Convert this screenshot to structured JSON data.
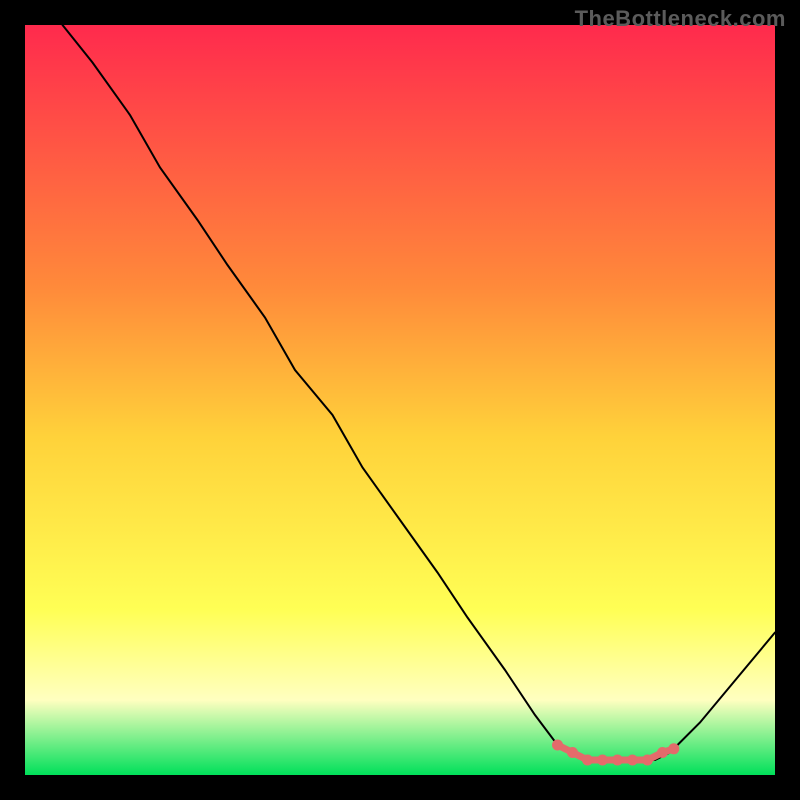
{
  "watermark": "TheBottleneck.com",
  "colors": {
    "gradient_top": "#ff2a4d",
    "gradient_upper_mid": "#ff8a3a",
    "gradient_mid": "#ffd23a",
    "gradient_lower_mid": "#ffff55",
    "gradient_low": "#ffffc0",
    "gradient_bottom": "#00e05a",
    "curve": "#000000",
    "markers": "#e46b6b",
    "frame": "#000000"
  },
  "chart_data": {
    "type": "line",
    "title": "",
    "xlabel": "",
    "ylabel": "",
    "x_range": [
      0,
      100
    ],
    "y_range": [
      0,
      100
    ],
    "series": [
      {
        "name": "bottleneck-curve",
        "x": [
          5,
          9,
          14,
          18,
          23,
          27,
          32,
          36,
          41,
          45,
          50,
          55,
          59,
          64,
          68,
          71,
          73,
          76,
          78,
          80,
          82,
          84,
          86,
          90,
          95,
          100
        ],
        "y": [
          100,
          95,
          88,
          81,
          74,
          68,
          61,
          54,
          48,
          41,
          34,
          27,
          21,
          14,
          8,
          4,
          3,
          2,
          2,
          2,
          2,
          2,
          3,
          7,
          13,
          19
        ]
      }
    ],
    "highlighted_segment": {
      "name": "sweet-spot-markers",
      "x": [
        71,
        73,
        75,
        77,
        79,
        81,
        83,
        85,
        86.5
      ],
      "y": [
        4,
        3,
        2,
        2,
        2,
        2,
        2,
        3,
        3.5
      ]
    },
    "background_gradient_stops": [
      {
        "pos": 0.0,
        "meaning": "worst",
        "color_key": "gradient_top"
      },
      {
        "pos": 0.35,
        "meaning": "bad",
        "color_key": "gradient_upper_mid"
      },
      {
        "pos": 0.55,
        "meaning": "ok",
        "color_key": "gradient_mid"
      },
      {
        "pos": 0.78,
        "meaning": "good",
        "color_key": "gradient_lower_mid"
      },
      {
        "pos": 0.9,
        "meaning": "great",
        "color_key": "gradient_low"
      },
      {
        "pos": 1.0,
        "meaning": "best",
        "color_key": "gradient_bottom"
      }
    ]
  }
}
